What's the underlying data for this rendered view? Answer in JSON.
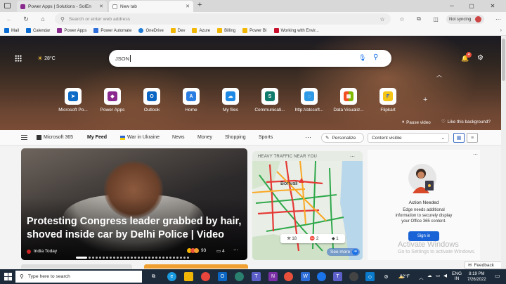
{
  "tabs": [
    {
      "label": "Power Apps | Solutions - SolEn",
      "active": false
    },
    {
      "label": "New tab",
      "active": true
    }
  ],
  "omnibox": {
    "placeholder": "Search or enter web address"
  },
  "profile": {
    "label": "Not syncing"
  },
  "favorites": [
    {
      "label": "Mail",
      "color": "#0a6bd3"
    },
    {
      "label": "Calendar",
      "color": "#0a6bd3"
    },
    {
      "label": "Power Apps",
      "color": "#8a2a8f"
    },
    {
      "label": "Power Automate",
      "color": "#2f6fdb"
    },
    {
      "label": "OneDrive",
      "color": "#1e7bd6"
    },
    {
      "label": "Dev",
      "color": "#f2b705"
    },
    {
      "label": "Azure",
      "color": "#2b6fd1"
    },
    {
      "label": "Billing",
      "color": "#f2b705"
    },
    {
      "label": "Power BI",
      "color": "#f2b705"
    },
    {
      "label": "Working with Envir...",
      "color": "#c8102e"
    }
  ],
  "hero": {
    "weather": "28°C",
    "search_value": "JSON",
    "notif_count": "4",
    "pause_label": "Pause video",
    "like_label": "Like this background?"
  },
  "quick_links": [
    {
      "label": "Microsoft Po...",
      "color": "#0b6bc7",
      "glyph": "➤"
    },
    {
      "label": "Power Apps",
      "color": "#8a2a8f",
      "glyph": "◆"
    },
    {
      "label": "Outlook",
      "color": "#0a66c2",
      "glyph": "O"
    },
    {
      "label": "Home",
      "color": "#2a7de1",
      "glyph": "A"
    },
    {
      "label": "My files",
      "color": "#1e88e5",
      "glyph": "☁"
    },
    {
      "label": "Communicati...",
      "color": "#0f7b6c",
      "glyph": "S"
    },
    {
      "label": "http://atcsoft...",
      "color": "#2f9be6",
      "glyph": "◌"
    },
    {
      "label": "Data Visualiz...",
      "color": "#e04e2d",
      "glyph": "▦"
    },
    {
      "label": "Flipkart",
      "color": "#f5c518",
      "glyph": "F"
    }
  ],
  "feed_nav": {
    "items": [
      "Microsoft 365",
      "My Feed",
      "War in Ukraine",
      "News",
      "Money",
      "Shopping",
      "Sports"
    ],
    "personalize": "Personalize",
    "content_visible": "Content visible"
  },
  "main_card": {
    "headline": "Protesting Congress leader grabbed by hair, shoved inside car by Delhi Police | Video",
    "source": "India Today",
    "reactions": "93",
    "comments": "4"
  },
  "traffic": {
    "title": "HEAVY TRAFFIC NEAR YOU",
    "place": "Borivali",
    "stat1": "18",
    "stat2": "2",
    "stat3": "1",
    "see_more": "See more"
  },
  "office_card": {
    "title": "Action Needed",
    "body": "Edge needs additional information to securely display your Office 365 content.",
    "button": "Sign in"
  },
  "watermark": {
    "line1": "Activate Windows",
    "line2": "Go to Settings to activate Windows."
  },
  "feedback": "Feedback",
  "taskbar": {
    "search_placeholder": "Type here to search",
    "temp": "82°F",
    "lang1": "ENG",
    "lang2": "IN",
    "time": "8:19 PM",
    "date": "7/26/2022"
  }
}
